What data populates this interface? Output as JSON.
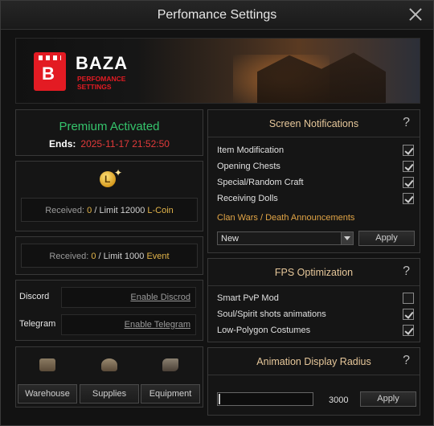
{
  "window": {
    "title": "Perfomance Settings"
  },
  "banner": {
    "brand": "BAZA",
    "subtitle": "PERFOMANCE SETTINGS",
    "logo_letter": "B"
  },
  "premium": {
    "status": "Premium Activated",
    "ends_label": "Ends:",
    "ends_value": "2025-11-17 21:52:50"
  },
  "lcoin": {
    "received_label": "Received:",
    "received_value": "0",
    "limit_text": " / Limit 12000 ",
    "unit": "L-Coin",
    "icon": "l-coin-icon"
  },
  "event": {
    "received_label": "Received:",
    "received_value": "0",
    "limit_text": " / Limit 1000 ",
    "unit": "Event"
  },
  "social": [
    {
      "label": "Discord",
      "action": "Enable Discrod"
    },
    {
      "label": "Telegram",
      "action": "Enable Telegram"
    }
  ],
  "storage": [
    {
      "label": "Warehouse",
      "icon": "warehouse-icon"
    },
    {
      "label": "Supplies",
      "icon": "supplies-icon"
    },
    {
      "label": "Equipment",
      "icon": "equipment-icon"
    }
  ],
  "notifications": {
    "title": "Screen Notifications",
    "help": "?",
    "options": [
      {
        "label": "Item Modification",
        "checked": true
      },
      {
        "label": "Opening Chests",
        "checked": true
      },
      {
        "label": "Special/Random Craft",
        "checked": true
      },
      {
        "label": "Receiving Dolls",
        "checked": true
      }
    ],
    "clan_label": "Clan Wars / Death Announcements",
    "select_value": "New",
    "apply": "Apply"
  },
  "fps": {
    "title": "FPS Optimization",
    "help": "?",
    "options": [
      {
        "label": "Smart PvP Mod",
        "checked": false
      },
      {
        "label": "Soul/Spirit shots animations",
        "checked": true
      },
      {
        "label": "Low-Polygon Costumes",
        "checked": true
      }
    ]
  },
  "radius": {
    "title": "Animation Display Radius",
    "help": "?",
    "value": "3000",
    "apply": "Apply"
  },
  "colors": {
    "accent_green": "#35c46c",
    "accent_red": "#e23a3a",
    "accent_gold": "#e2a546",
    "brand_red": "#e31b23"
  }
}
